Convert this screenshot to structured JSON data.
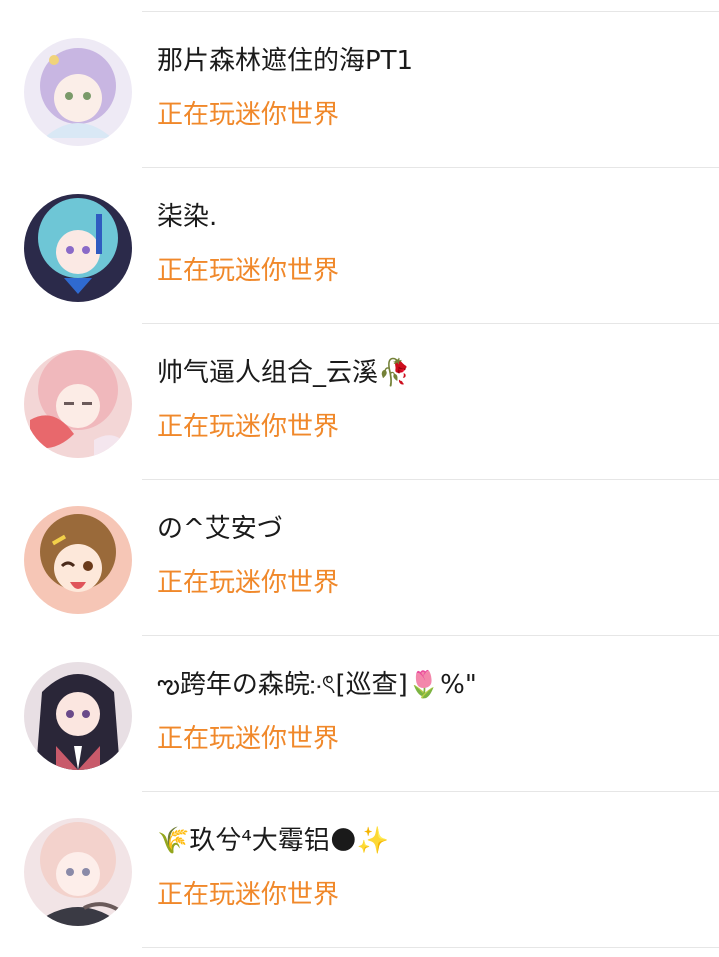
{
  "friends": [
    {
      "name": "那片森林遮住的海PT1",
      "status": "正在玩迷你世界",
      "avatar_icon": "anime-girl-lavender-icon"
    },
    {
      "name": "柒染.",
      "status": "正在玩迷你世界",
      "avatar_icon": "anime-girl-blue-hair-icon"
    },
    {
      "name": "帅气逼人组合_云溪🥀",
      "status": "正在玩迷你世界",
      "avatar_icon": "anime-girl-pink-hair-icon"
    },
    {
      "name": "の^艾安づ",
      "status": "正在玩迷你世界",
      "avatar_icon": "anime-girl-brown-hair-icon"
    },
    {
      "name": "ఌ跨年の森皖჻ৎ[巡查]🌷%\"",
      "status": "正在玩迷你世界",
      "avatar_icon": "anime-girl-dark-hair-icon"
    },
    {
      "name": "🌾玖兮⁴大霉铝🌑✨",
      "status": "正在玩迷你世界",
      "avatar_icon": "anime-girl-light-hair-icon"
    }
  ],
  "colors": {
    "status_text": "#f0882a",
    "name_text": "#1a1a1a",
    "divider": "#e6e6e6"
  }
}
